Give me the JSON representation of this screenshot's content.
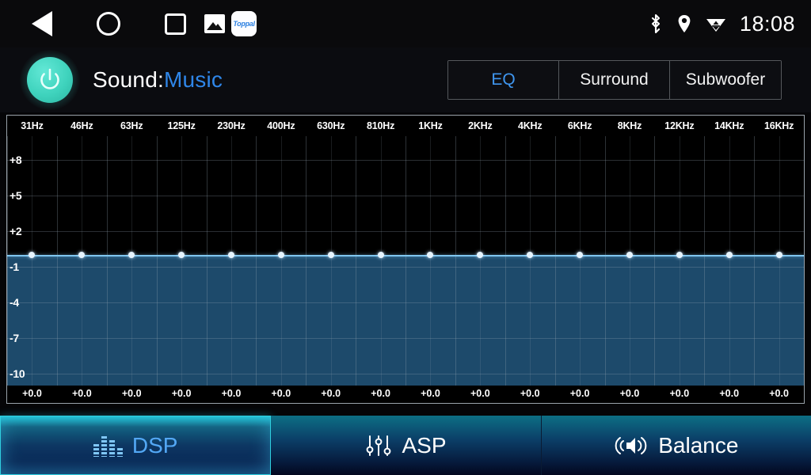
{
  "statusbar": {
    "nav": [
      {
        "name": "back-icon",
        "label": "Back"
      },
      {
        "name": "home-icon",
        "label": "Home"
      },
      {
        "name": "recents-icon",
        "label": "Recents"
      }
    ],
    "app_icons": [
      {
        "name": "gallery-icon",
        "label": ""
      },
      {
        "name": "toppal-app-icon",
        "label": "Toppal"
      }
    ],
    "indicators": [
      {
        "name": "bluetooth-icon"
      },
      {
        "name": "location-icon"
      },
      {
        "name": "wifi-icon"
      }
    ],
    "clock": "18:08"
  },
  "header": {
    "power_button": "power-icon",
    "sound_prefix": "Sound:",
    "sound_value": "Music",
    "mode_tabs": [
      {
        "label": "EQ",
        "active": true
      },
      {
        "label": "Surround",
        "active": false
      },
      {
        "label": "Subwoofer",
        "active": false
      }
    ]
  },
  "chart_data": {
    "type": "line",
    "title": "",
    "xlabel": "",
    "ylabel": "",
    "categories": [
      "31Hz",
      "46Hz",
      "63Hz",
      "125Hz",
      "230Hz",
      "400Hz",
      "630Hz",
      "810Hz",
      "1KHz",
      "2KHz",
      "4KHz",
      "6KHz",
      "8KHz",
      "12KHz",
      "14KHz",
      "16KHz"
    ],
    "values": [
      0.0,
      0.0,
      0.0,
      0.0,
      0.0,
      0.0,
      0.0,
      0.0,
      0.0,
      0.0,
      0.0,
      0.0,
      0.0,
      0.0,
      0.0,
      0.0
    ],
    "value_labels": [
      "+0.0",
      "+0.0",
      "+0.0",
      "+0.0",
      "+0.0",
      "+0.0",
      "+0.0",
      "+0.0",
      "+0.0",
      "+0.0",
      "+0.0",
      "+0.0",
      "+0.0",
      "+0.0",
      "+0.0",
      "+0.0"
    ],
    "ytick_labels": [
      "+8",
      "+5",
      "+2",
      "-1",
      "-4",
      "-7",
      "-10"
    ],
    "yticks": [
      8,
      5,
      2,
      -1,
      -4,
      -7,
      -10
    ],
    "ylim": [
      -11,
      10
    ],
    "grid": true,
    "legend": "none",
    "fill_color": "#1d4a6b",
    "line_color": "#7fc6ef",
    "point_color": "#e6f4fe",
    "background": "#000000"
  },
  "bottombar": {
    "tabs": [
      {
        "label": "DSP",
        "icon": "equalizer-bars-icon",
        "active": true
      },
      {
        "label": "ASP",
        "icon": "sliders-icon",
        "active": false
      },
      {
        "label": "Balance",
        "icon": "speaker-waves-icon",
        "active": false
      }
    ]
  },
  "colors": {
    "accent_blue": "#3f96ef",
    "power_teal": "#3fd3bd",
    "active_tab_cyan": "#2fd0e0",
    "chart_fill": "#1d4a6b"
  }
}
